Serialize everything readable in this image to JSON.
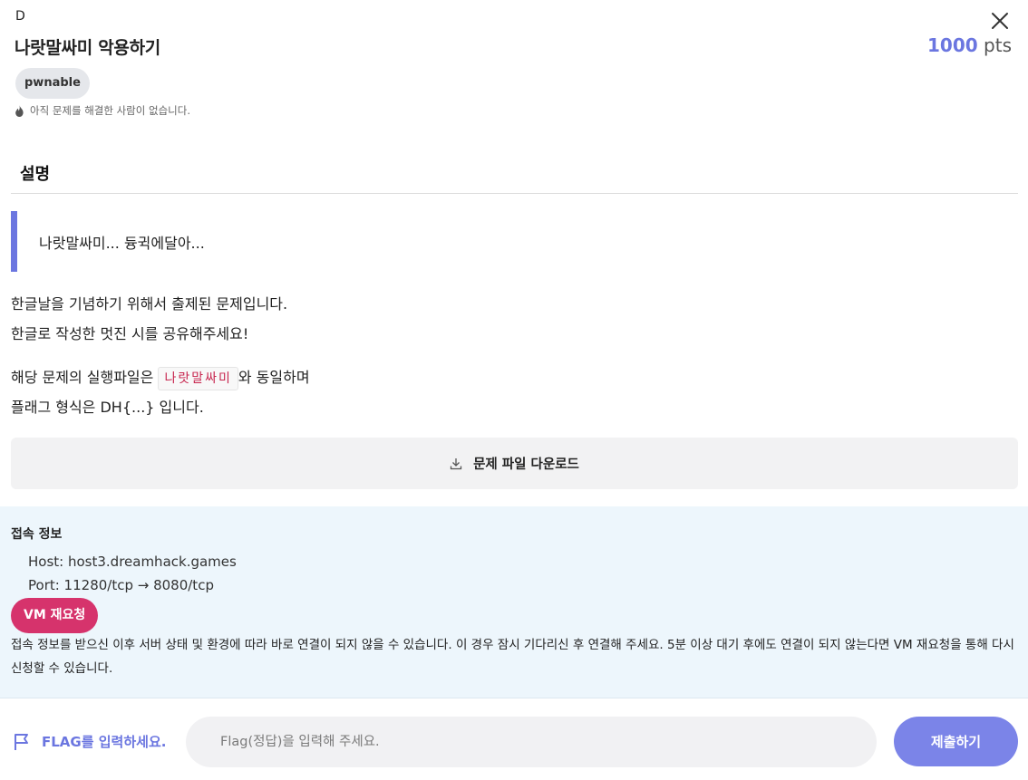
{
  "challenge": {
    "level": "D",
    "title": "나랏말싸미 악용하기",
    "points_value": "1000",
    "points_unit": "pts",
    "tag": "pwnable",
    "solve_status": "아직 문제를 해결한 사람이 없습니다."
  },
  "description": {
    "heading": "설명",
    "quote": "나랏말싸미... 듕귁에달아...",
    "line1": "한글날을 기념하기 위해서 출제된 문제입니다.",
    "line2": "한글로 작성한 멋진 시를 공유해주세요!",
    "line3_before": "해당 문제의 실행파일은 ",
    "line3_code": "나랏말싸미",
    "line3_after": "와 동일하며",
    "line4": "플래그 형식은 DH{...} 입니다.",
    "download_label": "문제 파일 다운로드"
  },
  "connection": {
    "title": "접속 정보",
    "host": "Host: host3.dreamhack.games",
    "port": "Port: 11280/tcp → 8080/tcp",
    "vm_button": "VM 재요청",
    "notice": "접속 정보를 받으신 이후 서버 상태 및 환경에 따라 바로 연결이 되지 않을 수 있습니다. 이 경우 잠시 기다리신 후 연결해 주세요. 5분 이상 대기 후에도 연결이 되지 않는다면 VM 재요청을 통해 다시 신청할 수 있습니다."
  },
  "flag_form": {
    "label": "FLAG를 입력하세요.",
    "placeholder": "Flag(정답)을 입력해 주세요.",
    "value": "",
    "submit_label": "제출하기"
  },
  "icons": {
    "close": "close-icon",
    "fire": "fire-icon",
    "download": "download-icon",
    "flag": "flag-icon"
  },
  "colors": {
    "accent": "#6b76e0",
    "vm_button": "#d6336c",
    "submit_button": "#7b84e8",
    "connection_panel": "#edf6fc"
  }
}
